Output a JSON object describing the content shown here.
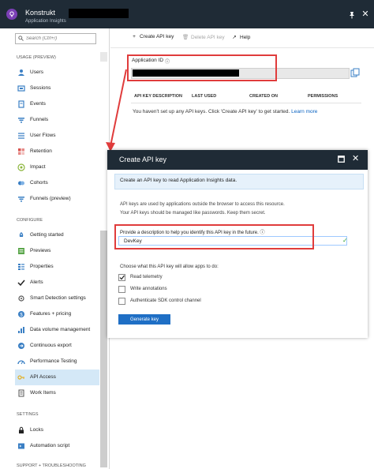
{
  "header": {
    "title": "Konstrukt",
    "subtitle": "Application Insights"
  },
  "sidebar": {
    "search_placeholder": "Search (Ctrl+/)",
    "sections": [
      {
        "label": "USAGE (PREVIEW)",
        "items": [
          {
            "label": "Users",
            "icon": "users-icon"
          },
          {
            "label": "Sessions",
            "icon": "sessions-icon"
          },
          {
            "label": "Events",
            "icon": "events-icon"
          },
          {
            "label": "Funnels",
            "icon": "funnels-icon"
          },
          {
            "label": "User Flows",
            "icon": "user-flows-icon"
          },
          {
            "label": "Retention",
            "icon": "retention-icon"
          },
          {
            "label": "Impact",
            "icon": "impact-icon"
          },
          {
            "label": "Cohorts",
            "icon": "cohorts-icon"
          },
          {
            "label": "Funnels (preview)",
            "icon": "funnels-preview-icon"
          }
        ]
      },
      {
        "label": "CONFIGURE",
        "items": [
          {
            "label": "Getting started",
            "icon": "rocket-icon"
          },
          {
            "label": "Previews",
            "icon": "previews-icon"
          },
          {
            "label": "Properties",
            "icon": "properties-icon"
          },
          {
            "label": "Alerts",
            "icon": "checkmark-icon"
          },
          {
            "label": "Smart Detection settings",
            "icon": "smart-detection-icon"
          },
          {
            "label": "Features + pricing",
            "icon": "pricing-icon"
          },
          {
            "label": "Data volume management",
            "icon": "data-volume-icon"
          },
          {
            "label": "Continuous export",
            "icon": "export-icon"
          },
          {
            "label": "Performance Testing",
            "icon": "performance-icon"
          },
          {
            "label": "API Access",
            "icon": "key-icon",
            "active": true
          },
          {
            "label": "Work Items",
            "icon": "work-items-icon"
          }
        ]
      },
      {
        "label": "SETTINGS",
        "items": [
          {
            "label": "Locks",
            "icon": "lock-icon"
          },
          {
            "label": "Automation script",
            "icon": "script-icon"
          }
        ]
      },
      {
        "label": "SUPPORT + TROUBLESHOOTING",
        "items": []
      }
    ]
  },
  "toolbar": {
    "create_label": "Create API key",
    "delete_label": "Delete API key",
    "help_label": "Help"
  },
  "main": {
    "app_id_label": "Application ID",
    "columns": [
      "API KEY DESCRIPTION",
      "LAST USED",
      "CREATED ON",
      "PERMISSIONS"
    ],
    "empty_message": "You haven't set up any API keys. Click 'Create API key' to get started.",
    "learn_more": "Learn more"
  },
  "dialog": {
    "title": "Create API key",
    "banner": "Create an API key to read Application Insights data.",
    "info_line1": "API keys are used by applications outside the browser to access this resource.",
    "info_line2": "Your API keys should be managed like passwords. Keep them secret.",
    "description_label": "Provide a description to help you identify this API key in the future.",
    "description_value": "DevKey",
    "choose_label": "Choose what this API key will allow apps to do:",
    "permissions": [
      {
        "label": "Read telemetry",
        "checked": true
      },
      {
        "label": "Write annotations",
        "checked": false
      },
      {
        "label": "Authenticate SDK control channel",
        "checked": false
      }
    ],
    "generate_label": "Generate key"
  },
  "colors": {
    "header_bg": "#1f2b36",
    "accent": "#1f6fc5",
    "highlight_red": "#e03c3c",
    "active_item_bg": "#d4e8f7"
  }
}
